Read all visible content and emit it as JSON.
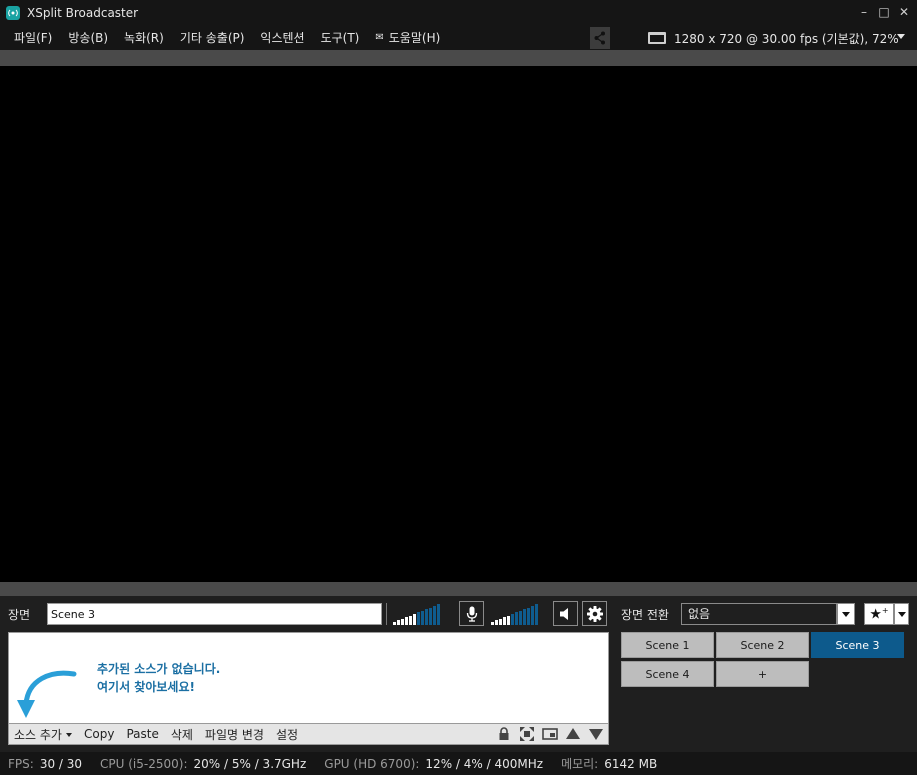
{
  "window": {
    "title": "XSplit Broadcaster",
    "minimize": "–",
    "maximize": "□",
    "close": "✕"
  },
  "menu": {
    "items": [
      "파일(F)",
      "방송(B)",
      "녹화(R)",
      "기타 송출(P)",
      "익스텐션",
      "도구(T)",
      "도움말(H)"
    ],
    "resolution": "1280 x 720 @ 30.00 fps (기본값), 72%"
  },
  "scene": {
    "label": "장면",
    "name_value": "Scene 3"
  },
  "audio": {
    "mic_level_bars": 6,
    "speaker_level_bars": 5,
    "total_bars": 12
  },
  "transition": {
    "label": "장면 전환",
    "selected": "없음"
  },
  "sources": {
    "empty_line1": "추가된 소스가 없습니다.",
    "empty_line2": "여기서 찾아보세요!",
    "toolbar": {
      "add_source": "소스 추가",
      "copy": "Copy",
      "paste": "Paste",
      "delete": "삭제",
      "rename": "파일명 변경",
      "settings": "설정"
    }
  },
  "scenes": [
    {
      "label": "Scene 1",
      "active": false
    },
    {
      "label": "Scene 2",
      "active": false
    },
    {
      "label": "Scene 3",
      "active": true
    },
    {
      "label": "Scene 4",
      "active": false
    },
    {
      "label": "+",
      "active": false
    }
  ],
  "status": {
    "fps_label": "FPS:",
    "fps_value": "30 / 30",
    "cpu_label": "CPU (i5-2500):",
    "cpu_value": "20% / 5% / 3.7GHz",
    "gpu_label": "GPU (HD 6700):",
    "gpu_value": "12% / 4% / 400MHz",
    "mem_label": "메모리:",
    "mem_value": "6142 MB"
  },
  "colors": {
    "accent": "#0d5a8c",
    "meter_active": "#ffffff",
    "meter_inactive": "#0f5c8f",
    "hint_text": "#1b6fa3",
    "app_icon": "#1aa3a3"
  }
}
